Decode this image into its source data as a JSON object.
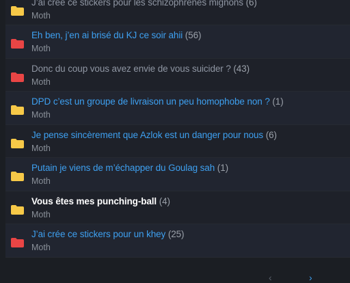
{
  "colors": {
    "folder_yellow": "#f7c948",
    "folder_red": "#e94545",
    "link": "#3ea0f0",
    "visited": "#8f96a3"
  },
  "topics": [
    {
      "title": "J’ai créé ce stickers pour les schizophrènes mignons",
      "count": "(6)",
      "author": "Moth",
      "folder": "yellow",
      "state": "visited"
    },
    {
      "title": "Eh ben, j’en ai brisé du KJ ce soir ahii",
      "count": "(56)",
      "author": "Moth",
      "folder": "red",
      "state": "link"
    },
    {
      "title": "Donc du coup vous avez envie de vous suicider ?",
      "count": "(43)",
      "author": "Moth",
      "folder": "red",
      "state": "visited"
    },
    {
      "title": "DPD c’est un groupe de livraison un peu homophobe non ?",
      "count": "(1)",
      "author": "Moth",
      "folder": "yellow",
      "state": "link"
    },
    {
      "title": "Je pense sincèrement que Azlok est un danger pour nous",
      "count": "(6)",
      "author": "Moth",
      "folder": "yellow",
      "state": "link"
    },
    {
      "title": "Putain je viens de m’échapper du Goulag sah",
      "count": "(1)",
      "author": "Moth",
      "folder": "yellow",
      "state": "link"
    },
    {
      "title": "Vous êtes mes punching-ball",
      "count": "(4)",
      "author": "Moth",
      "folder": "yellow",
      "state": "bold"
    },
    {
      "title": "J’ai crée ce stickers pour un khey",
      "count": "(25)",
      "author": "Moth",
      "folder": "red",
      "state": "link"
    }
  ],
  "pager": {
    "prev_icon": "chevron-left-icon",
    "next_icon": "chevron-right-icon"
  }
}
